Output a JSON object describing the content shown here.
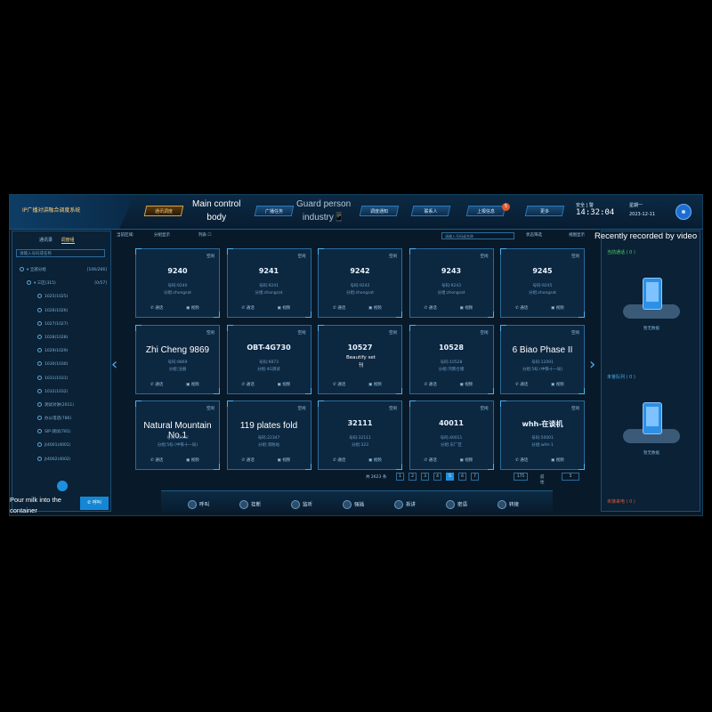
{
  "app": {
    "brand": "IP广播对讲融合调度系统",
    "colors": {
      "background": "#081a2a",
      "accent": "#1d8fe0",
      "active_tab": "#ffd07a",
      "alert": "#e2572e"
    }
  },
  "nav": [
    {
      "label": "通讯调度",
      "active": true
    },
    {
      "label": ""
    },
    {
      "label": "广播任务"
    },
    {
      "label": ""
    },
    {
      "label": "调度通知"
    },
    {
      "label": "联系人"
    },
    {
      "label": "上报信息",
      "badge": "5"
    },
    {
      "label": "更多"
    }
  ],
  "captions": {
    "main_control": "Main control\nbody",
    "guard_person": "Guard person\nindustry📱",
    "recently_recorded": "Recently recorded by video",
    "pour_milk": "Pour milk into the\ncontainer"
  },
  "header": {
    "status": "安全 | 警",
    "time": "14:32:04",
    "weekday": "星期一",
    "date": "2023-12-11"
  },
  "sidebar": {
    "tabs": [
      "通讯录",
      "调度组"
    ],
    "search_placeholder": "请输入号码或名称",
    "tree": [
      {
        "label": "▾ 全部分组",
        "count": "[106/266]"
      },
      {
        "label": "▾ 三区(315)",
        "count": "[0/57]"
      },
      {
        "label": "1025(1025)"
      },
      {
        "label": "1026(1026)"
      },
      {
        "label": "1027(1027)"
      },
      {
        "label": "1028(1028)"
      },
      {
        "label": "1029(1029)"
      },
      {
        "label": "1030(1030)"
      },
      {
        "label": "1031(1031)"
      },
      {
        "label": "1032(1032)"
      },
      {
        "label": "测试对讲(2011)"
      },
      {
        "label": "办公电话(786)"
      },
      {
        "label": "SIP-测试(781)"
      },
      {
        "label": "jt4001(4001)"
      },
      {
        "label": "jt4002(4002)"
      }
    ],
    "call_button": "呼叫"
  },
  "toolbar": {
    "current": "当前区域:",
    "group": "分组显示",
    "list": "列表 ☐",
    "search_placeholder": "请输入号码或名称",
    "status_filter": "状态筛选",
    "tile_view": "视图显示"
  },
  "cards": [
    {
      "num": "9240",
      "no": "号码:9240",
      "group": "分组:zhongsat",
      "status": "空闲"
    },
    {
      "num": "9241",
      "no": "号码:9241",
      "group": "分组:zhongsat",
      "status": "空闲"
    },
    {
      "num": "9242",
      "no": "号码:9242",
      "group": "分组:zhongsat",
      "status": "空闲"
    },
    {
      "num": "9243",
      "no": "号码:9243",
      "group": "分组:zhongsat",
      "status": "空闲"
    },
    {
      "num": "9245",
      "no": "号码:9245",
      "group": "分组:zhongsat",
      "status": "空闲"
    },
    {
      "num": "Zhi Cheng 9869",
      "no": "号码:9869",
      "group": "分组:注册",
      "status": "空闲",
      "caption": true
    },
    {
      "num": "OBT-4G730",
      "no": "号码:9873",
      "group": "分组:4G测试",
      "status": "空闲"
    },
    {
      "num": "10527",
      "no": "",
      "group": "",
      "status": "空闲",
      "overlay": "Beautify set\n刊"
    },
    {
      "num": "10528",
      "no": "号码:10528",
      "group": "分组:河南仓储",
      "status": "空闲"
    },
    {
      "num": "6 Biao Phase II",
      "no": "号码:12091",
      "group": "分组:5标 (中铁十一局)",
      "status": "空闲",
      "caption": true
    },
    {
      "num": "Natural Mountain No.1",
      "no": "号码:12092",
      "group": "分组:5标 (中铁十一局)",
      "status": "空闲",
      "caption": true
    },
    {
      "num": "119 plates fold",
      "no": "号码:22347",
      "group": "分组:消防站",
      "status": "空闲",
      "caption": true
    },
    {
      "num": "32111",
      "no": "号码:32111",
      "group": "分组:323",
      "status": "空闲"
    },
    {
      "num": "40011",
      "no": "号码:40011",
      "group": "分组:东厂区",
      "status": "空闲"
    },
    {
      "num": "whh-在谈机",
      "no": "号码:50001",
      "group": "分组:whh-1",
      "status": "空闲"
    }
  ],
  "card_actions": {
    "call": "通话",
    "monitor": "视频"
  },
  "pagination": {
    "total": "共 2623 条",
    "pages": [
      "1",
      "2",
      "3",
      "4",
      "5",
      "6",
      "7"
    ],
    "active": "5",
    "last": "175",
    "goto_label": "前往",
    "goto_value": "5"
  },
  "bottom_bar": [
    "呼叫",
    "挂断",
    "监听",
    "强插",
    "拆讲",
    "密语",
    "转接"
  ],
  "right_panel": {
    "current_call": "当前通话 ( 0 )",
    "queue": "未答队列 ( 0 )",
    "missed": "未接来电 ( 0 )",
    "empty_text": "暂无数据"
  }
}
